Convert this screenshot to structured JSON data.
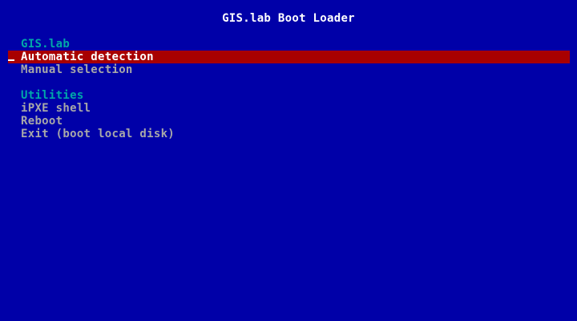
{
  "title": "GIS.lab Boot Loader",
  "menu": {
    "section1_header": "GIS.lab",
    "items1": [
      {
        "label": "Automatic detection",
        "selected": true
      },
      {
        "label": "Manual selection",
        "selected": false
      }
    ],
    "section2_header": "Utilities",
    "items2": [
      {
        "label": "iPXE shell"
      },
      {
        "label": "Reboot"
      },
      {
        "label": "Exit (boot local disk)"
      }
    ]
  },
  "colors": {
    "background": "#0000a8",
    "header": "#00a8a8",
    "item": "#a8a8a8",
    "selected_bg": "#a80000",
    "selected_fg": "#ffffff",
    "title": "#ffffff"
  }
}
